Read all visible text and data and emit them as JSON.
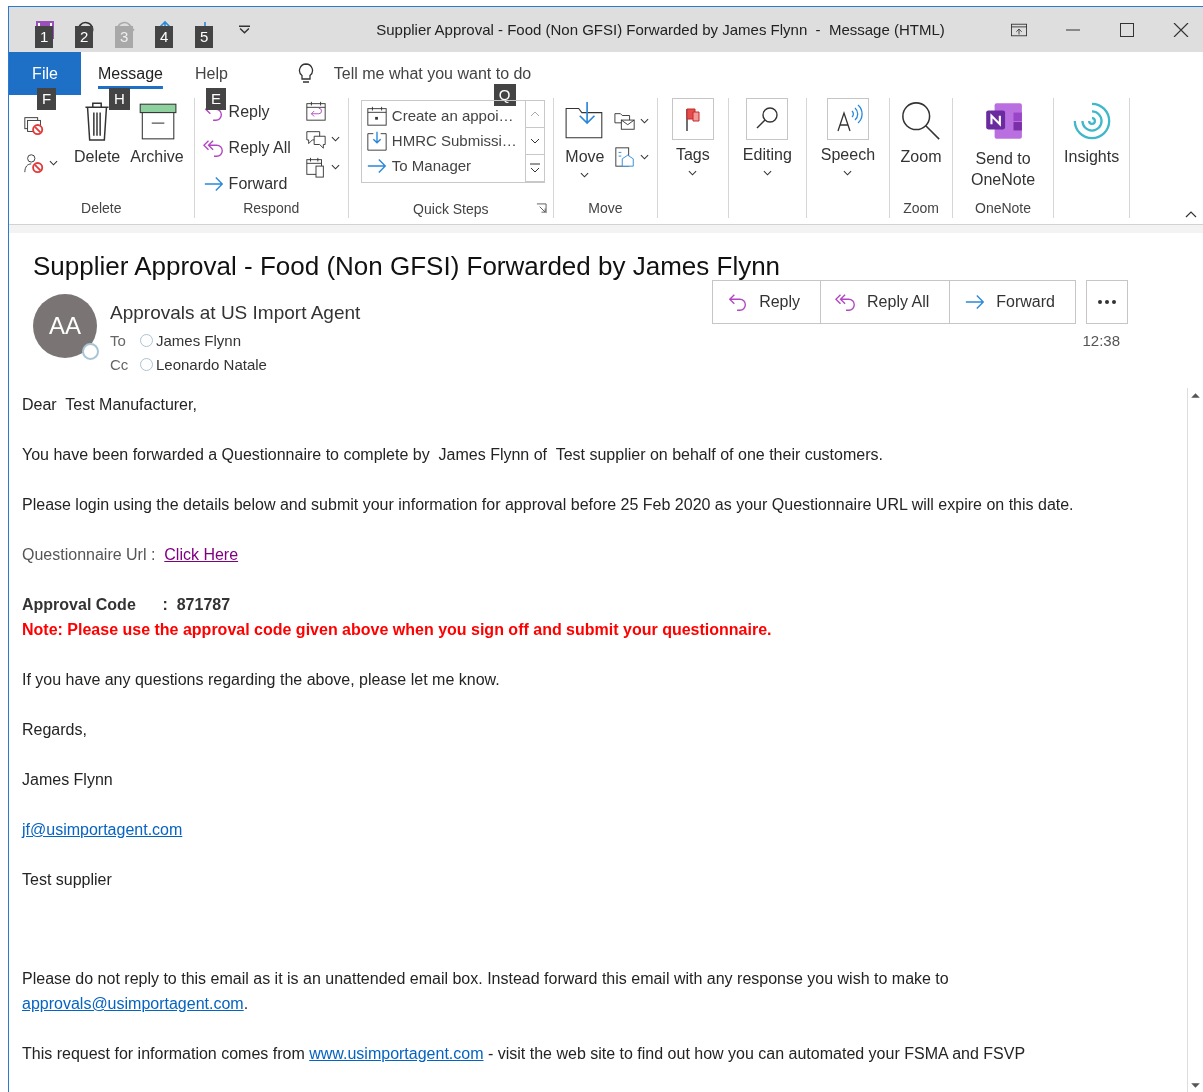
{
  "window": {
    "title": "Supplier Approval - Food (Non GFSI) Forwarded by James Flynn  -  Message (HTML)",
    "quick_access": [
      {
        "kind": "save",
        "keytip": "1",
        "disabled": false
      },
      {
        "kind": "undo",
        "keytip": "2",
        "disabled": false
      },
      {
        "kind": "redo",
        "keytip": "3",
        "disabled": true
      },
      {
        "kind": "up",
        "keytip": "4",
        "disabled": false
      },
      {
        "kind": "down",
        "keytip": "5",
        "disabled": false
      }
    ]
  },
  "tabs": [
    {
      "label": "File",
      "kind": "file",
      "keytip": "F",
      "selected": false
    },
    {
      "label": "Message",
      "kind": "tab",
      "keytip": "H",
      "selected": true
    },
    {
      "label": "Help",
      "kind": "tab",
      "keytip": "E",
      "selected": false
    }
  ],
  "tell_me": {
    "placeholder": "Tell me what you want to do",
    "keytip": "Q"
  },
  "ribbon": {
    "delete_group": {
      "label": "Delete",
      "delete": "Delete",
      "archive": "Archive"
    },
    "respond": {
      "label": "Respond",
      "reply": "Reply",
      "reply_all": "Reply All",
      "forward": "Forward"
    },
    "quick_steps": {
      "label": "Quick Steps",
      "items": [
        {
          "kind": "calendar",
          "label": "Create an appoi…"
        },
        {
          "kind": "inbox",
          "label": "HMRC Submissi…"
        },
        {
          "kind": "arrow",
          "label": "To Manager"
        }
      ]
    },
    "move": {
      "label": "Move",
      "button": "Move"
    },
    "tags": "Tags",
    "editing": "Editing",
    "speech": "Speech",
    "zoom": {
      "label": "Zoom",
      "button": "Zoom"
    },
    "onenote": {
      "label": "OneNote",
      "button": "Send to OneNote"
    },
    "insights": "Insights"
  },
  "message": {
    "subject": "Supplier Approval - Food (Non GFSI) Forwarded by James Flynn",
    "avatar": "AA",
    "sender": "Approvals at US Import Agent",
    "to": {
      "label": "To",
      "name": "James Flynn"
    },
    "cc": {
      "label": "Cc",
      "name": "Leonardo Natale"
    },
    "actions": [
      {
        "kind": "reply",
        "label": "Reply"
      },
      {
        "kind": "replyall",
        "label": "Reply All"
      },
      {
        "kind": "forward",
        "label": "Forward"
      }
    ],
    "time": "12:38"
  },
  "body": [
    {
      "kind": "plain",
      "parts": [
        {
          "kind": "text",
          "text": "Dear  Test Manufacturer,"
        }
      ]
    },
    {
      "kind": "plain",
      "parts": [
        {
          "kind": "text",
          "text": "You have been forwarded a Questionnaire to complete by  James Flynn of  Test supplier on behalf of one their customers."
        }
      ]
    },
    {
      "kind": "plain",
      "parts": [
        {
          "kind": "text",
          "text": "Please login using the details below and submit your information for approval before 25 Feb 2020 as your Questionnaire URL will expire on this date."
        }
      ]
    },
    {
      "kind": "muted",
      "parts": [
        {
          "kind": "text",
          "text": "Questionnaire Url :  "
        },
        {
          "kind": "visited",
          "text": "Click Here"
        }
      ]
    },
    {
      "kind": "code",
      "parts": [
        {
          "kind": "text",
          "text": "Approval Code      :  871787"
        }
      ]
    },
    {
      "kind": "note",
      "parts": [
        {
          "kind": "text",
          "text": "Note: Please use the approval code given above when you sign off and submit your questionnaire."
        }
      ]
    },
    {
      "kind": "plain",
      "parts": [
        {
          "kind": "text",
          "text": "If you have any questions regarding the above, please let me know."
        }
      ]
    },
    {
      "kind": "plain",
      "parts": [
        {
          "kind": "text",
          "text": "Regards,"
        }
      ]
    },
    {
      "kind": "plain",
      "parts": [
        {
          "kind": "text",
          "text": "James Flynn"
        }
      ]
    },
    {
      "kind": "plain",
      "parts": [
        {
          "kind": "link",
          "text": "jf@usimportagent.com"
        }
      ]
    },
    {
      "kind": "plain",
      "parts": [
        {
          "kind": "text",
          "text": "Test supplier"
        }
      ]
    }
  ],
  "footer": [
    {
      "kind": "plain",
      "parts": [
        {
          "kind": "text",
          "text": "Please do not reply to this email as it is an unattended email box. Instead forward this email with any response you wish to make to "
        },
        {
          "kind": "link",
          "text": "approvals@usimportagent.com"
        },
        {
          "kind": "text",
          "text": "."
        }
      ]
    },
    {
      "kind": "plain",
      "parts": [
        {
          "kind": "text",
          "text": "This request for information comes from "
        },
        {
          "kind": "link",
          "text": "www.usimportagent.com"
        },
        {
          "kind": "text",
          "text": " - visit the web site to find out how you can automated your FSMA and FSVP"
        }
      ]
    }
  ]
}
